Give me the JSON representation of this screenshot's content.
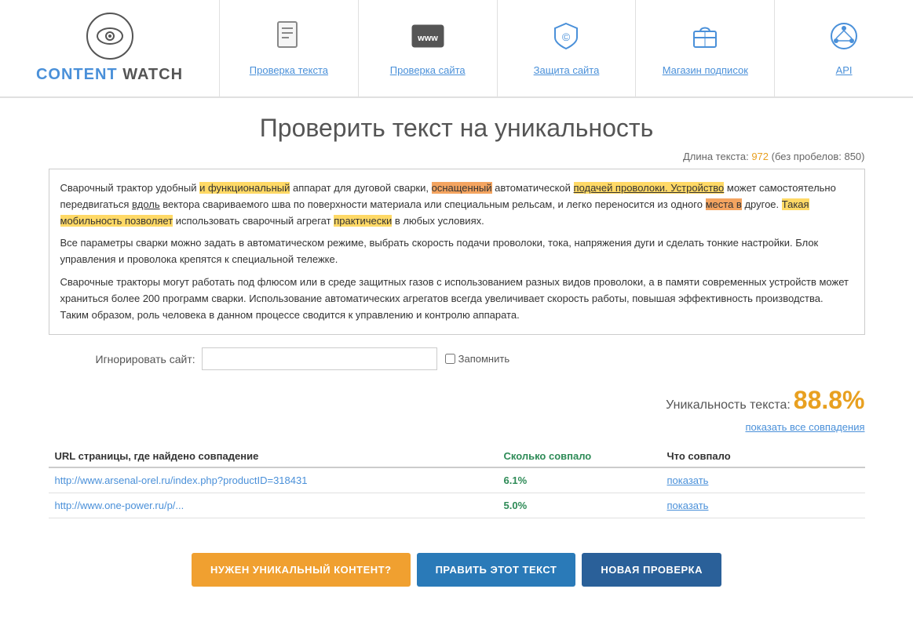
{
  "header": {
    "logo": {
      "text_content": "CONTENT WATCH",
      "text_watch": "WATCH",
      "text_content_part": "CONTENT"
    },
    "nav": [
      {
        "id": "check-text",
        "label": "Проверка текста",
        "icon": "📄"
      },
      {
        "id": "check-site",
        "label": "Проверка сайта",
        "icon": "🌐"
      },
      {
        "id": "protect-site",
        "label": "Защита сайта",
        "icon": "🛡"
      },
      {
        "id": "shop",
        "label": "Магазин подписок",
        "icon": "🛒"
      },
      {
        "id": "api",
        "label": "API",
        "icon": "🔗"
      }
    ]
  },
  "main": {
    "page_title": "Проверить текст на уникальность",
    "text_length_label": "Длина текста:",
    "text_length_value": "972",
    "text_length_no_spaces": "(без пробелов: 850)",
    "text_content_p1": "Сварочный трактор удобный и функциональный аппарат для дуговой сварки, оснащенный автоматической подачей проволоки. Устройство может самостоятельно передвигаться вдоль вектора свариваемого шва по поверхности материала или специальным рельсам, и легко переносится из одного места в другое. Такая мобильность позволяет использовать сварочный агрегат практически в любых условиях.",
    "text_content_p2": "Все параметры сварки можно задать в автоматическом режиме, выбрать скорость подачи проволоки, тока, напряжения дуги и сделать тонкие настройки. Блок управления и проволока крепятся к специальной тележке.",
    "text_content_p3": "Сварочные тракторы могут работать под флюсом или в среде защитных газов с использованием разных видов проволоки, а в памяти современных устройств может храниться более 200 программ сварки. Использование автоматических агрегатов всегда увеличивает скорость работы, повышая эффективность производства. Таким образом, роль человека в данном процессе сводится к управлению и контролю аппарата.",
    "ignore_label": "Игнорировать сайт:",
    "ignore_placeholder": "",
    "remember_label": "Запомнить",
    "uniqueness_label": "Уникальность текста:",
    "uniqueness_value": "88.8%",
    "show_all_label": "показать все совпадения",
    "table": {
      "col1": "URL страницы, где найдено совпадение",
      "col2": "Сколько совпало",
      "col3": "Что совпало",
      "rows": [
        {
          "url": "http://www.arsenal-orel.ru/index.php?productID=318431",
          "match": "6.1%",
          "show": "показать"
        },
        {
          "url": "http://www.one-power.ru/p/...",
          "match": "5.0%",
          "show": "показать"
        }
      ]
    },
    "btn_unique": "НУЖЕН УНИКАЛЬНЫЙ КОНТЕНТ?",
    "btn_edit": "ПРАВИТЬ ЭТОТ ТЕКСТ",
    "btn_new": "НОВАЯ ПРОВЕРКА"
  }
}
